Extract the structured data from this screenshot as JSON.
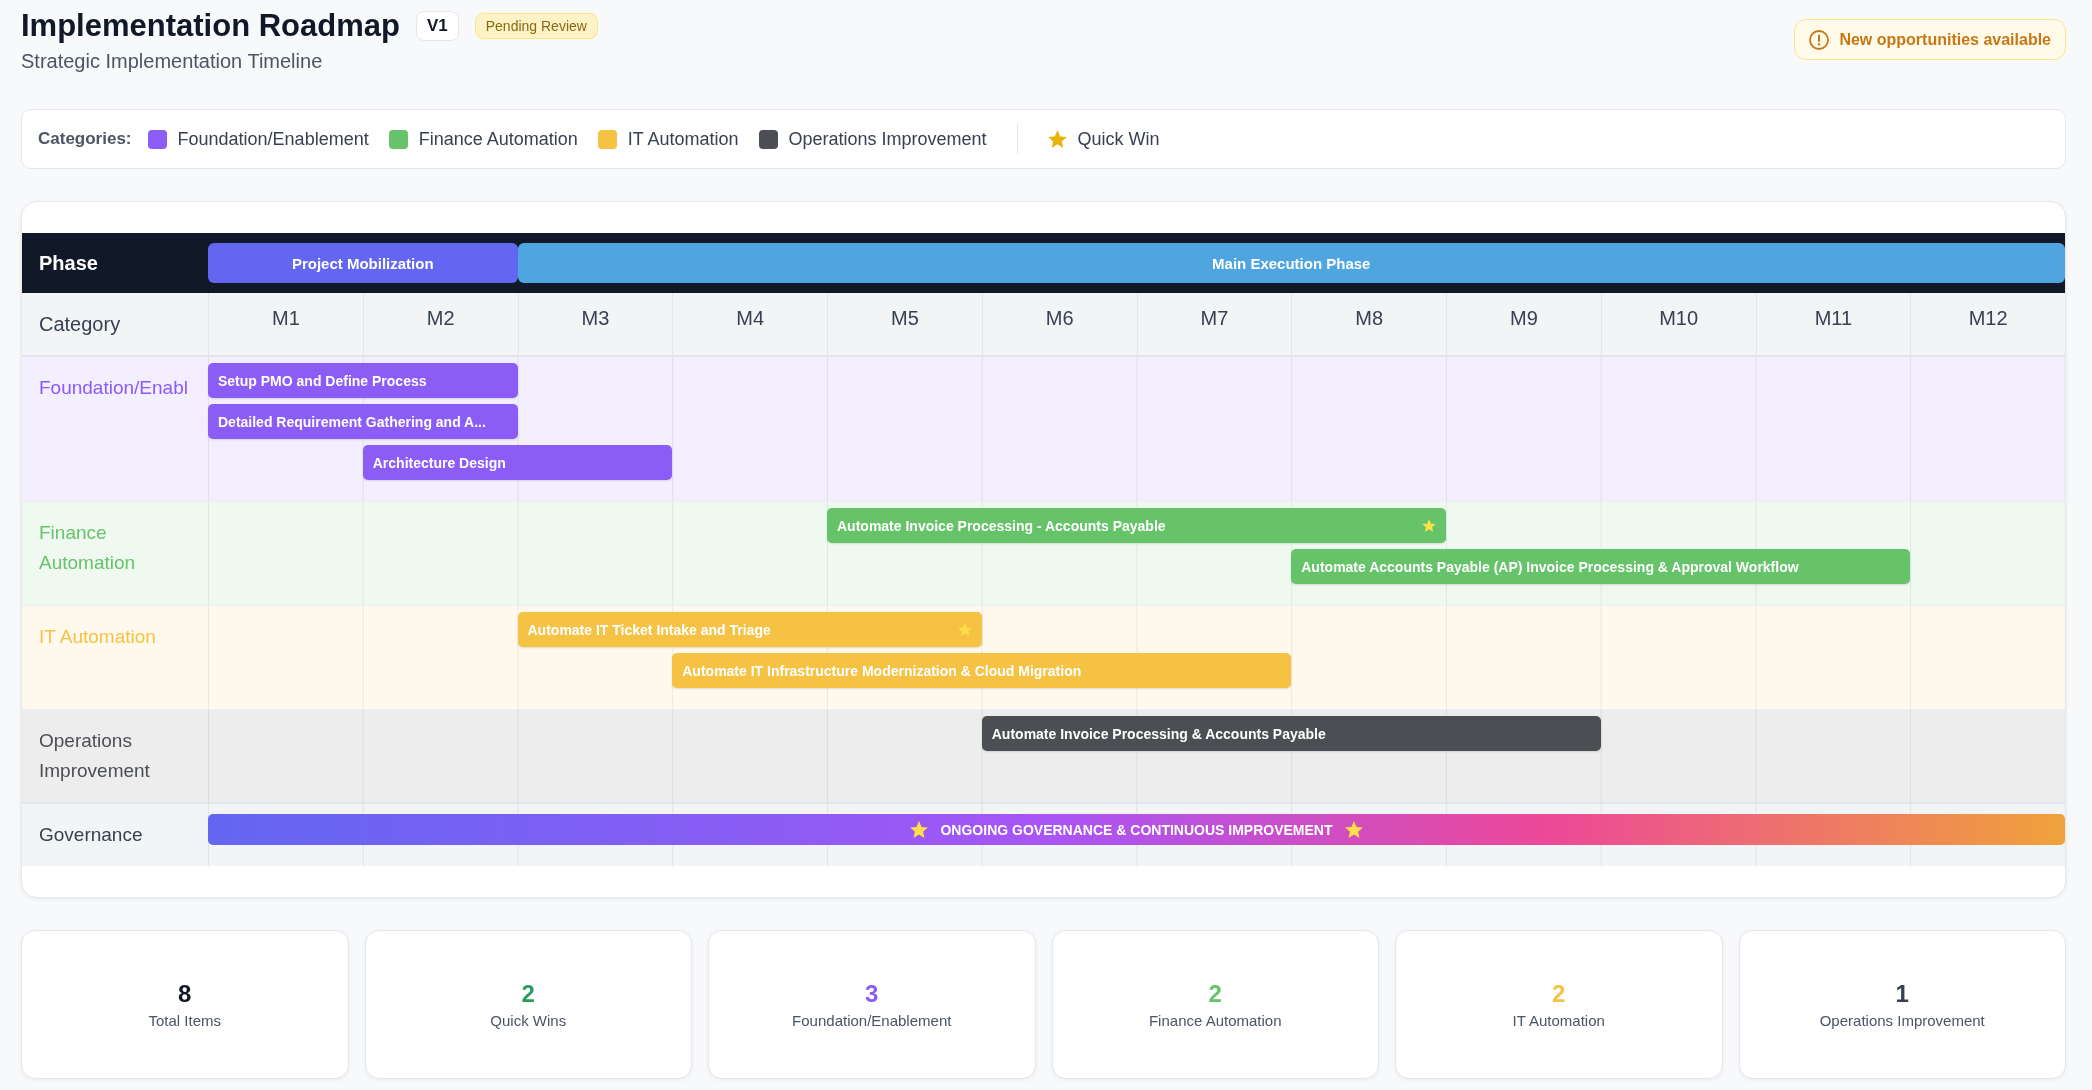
{
  "header": {
    "title": "Implementation Roadmap",
    "version": "V1",
    "status": "Pending Review",
    "subtitle": "Strategic Implementation Timeline"
  },
  "alert": {
    "text": "New opportunities available"
  },
  "legend": {
    "label": "Categories:",
    "items": [
      {
        "label": "Foundation/Enablement",
        "color": "#8b5cf6"
      },
      {
        "label": "Finance Automation",
        "color": "#66c36a"
      },
      {
        "label": "IT Automation",
        "color": "#f5c244"
      },
      {
        "label": "Operations Improvement",
        "color": "#4b4f54"
      }
    ],
    "quick_win": "Quick Win"
  },
  "roadmap": {
    "phase_label": "Phase",
    "phases": [
      {
        "label": "Project Mobilization",
        "color": "#6366f1"
      },
      {
        "label": "Main Execution Phase",
        "color": "#4ea5e0"
      }
    ],
    "category_label": "Category",
    "months": [
      "M1",
      "M2",
      "M3",
      "M4",
      "M5",
      "M6",
      "M7",
      "M8",
      "M9",
      "M10",
      "M11",
      "M12"
    ],
    "categories": [
      {
        "label": "Foundation/Enabl",
        "color": "#8b5cf6",
        "tasks": [
          {
            "label": "Setup PMO and Define Process",
            "quick_win": false
          },
          {
            "label": "Detailed Requirement Gathering and A...",
            "quick_win": false
          },
          {
            "label": "Architecture Design",
            "quick_win": false
          }
        ]
      },
      {
        "label": "Finance Automation",
        "color": "#66c36a",
        "tasks": [
          {
            "label": "Automate Invoice Processing - Accounts Payable",
            "quick_win": true
          },
          {
            "label": "Automate Accounts Payable (AP) Invoice Processing & Approval Workflow",
            "quick_win": false
          }
        ]
      },
      {
        "label": "IT Automation",
        "color": "#f5c244",
        "tasks": [
          {
            "label": "Automate IT Ticket Intake and Triage",
            "quick_win": true
          },
          {
            "label": "Automate IT Infrastructure Modernization & Cloud Migration",
            "quick_win": false
          }
        ]
      },
      {
        "label": "Operations Improvement",
        "color": "#4b4f54",
        "tasks": [
          {
            "label": "Automate Invoice Processing & Accounts Payable",
            "quick_win": false
          }
        ]
      }
    ],
    "governance": {
      "label": "Governance",
      "banner": "ONGOING GOVERNANCE & CONTINUOUS IMPROVEMENT"
    }
  },
  "stats": [
    {
      "value": "8",
      "label": "Total Items",
      "color": "#111827"
    },
    {
      "value": "2",
      "label": "Quick Wins",
      "color": "#2e9b5e"
    },
    {
      "value": "3",
      "label": "Foundation/Enablement",
      "color": "#8b5cf6"
    },
    {
      "value": "2",
      "label": "Finance Automation",
      "color": "#66c36a"
    },
    {
      "value": "2",
      "label": "IT Automation",
      "color": "#f5c244"
    },
    {
      "value": "1",
      "label": "Operations Improvement",
      "color": "#374151"
    }
  ]
}
